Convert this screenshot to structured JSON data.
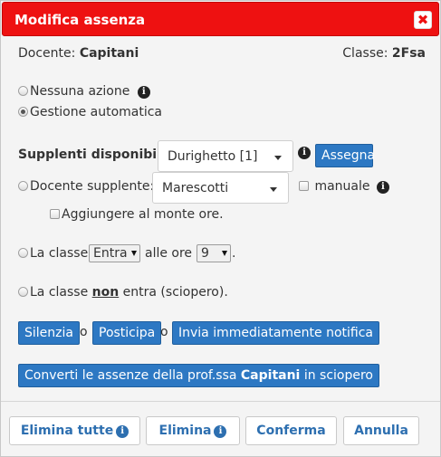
{
  "dialog": {
    "title": "Modifica assenza",
    "close_glyph": "✖"
  },
  "header": {
    "docente_label": "Docente:",
    "docente_value": "Capitani",
    "classe_label": "Classe:",
    "classe_value": "2Fsa"
  },
  "options": {
    "nessuna_azione": "Nessuna azione",
    "gestione_automatica": "Gestione automatica",
    "selected": "gestione_automatica"
  },
  "supplenti": {
    "label": "Supplenti disponibili:",
    "selected": "Durighetto [1]",
    "assegna_label": "Assegna"
  },
  "docente_supplente": {
    "label": "Docente supplente:",
    "selected": "Marescotti",
    "manuale_label": "manuale",
    "monte_ore_label": "Aggiungere al monte ore."
  },
  "classe_entra": {
    "prefix": "La classe",
    "action_selected": "Entra",
    "middle": "alle ore",
    "hour_selected": "9",
    "suffix": "."
  },
  "sciopero": {
    "prefix": "La classe",
    "emph": "non",
    "suffix": "entra (sciopero)."
  },
  "actions": {
    "silenzia": "Silenzia",
    "o1": "o",
    "posticipa": "Posticipa",
    "o2": "o",
    "invia": "Invia immediatamente notifica",
    "converti_pre": "Converti le assenze della prof.ssa",
    "converti_name": "Capitani",
    "converti_post": "in sciopero"
  },
  "footer": {
    "elimina_tutte": "Elimina tutte",
    "elimina": "Elimina",
    "conferma": "Conferma",
    "annulla": "Annulla"
  },
  "icons": {
    "info_glyph": "i"
  },
  "colors": {
    "titlebar": "#ee1111",
    "primary_button": "#2d78c3",
    "footer_text": "#2d6fb0"
  }
}
